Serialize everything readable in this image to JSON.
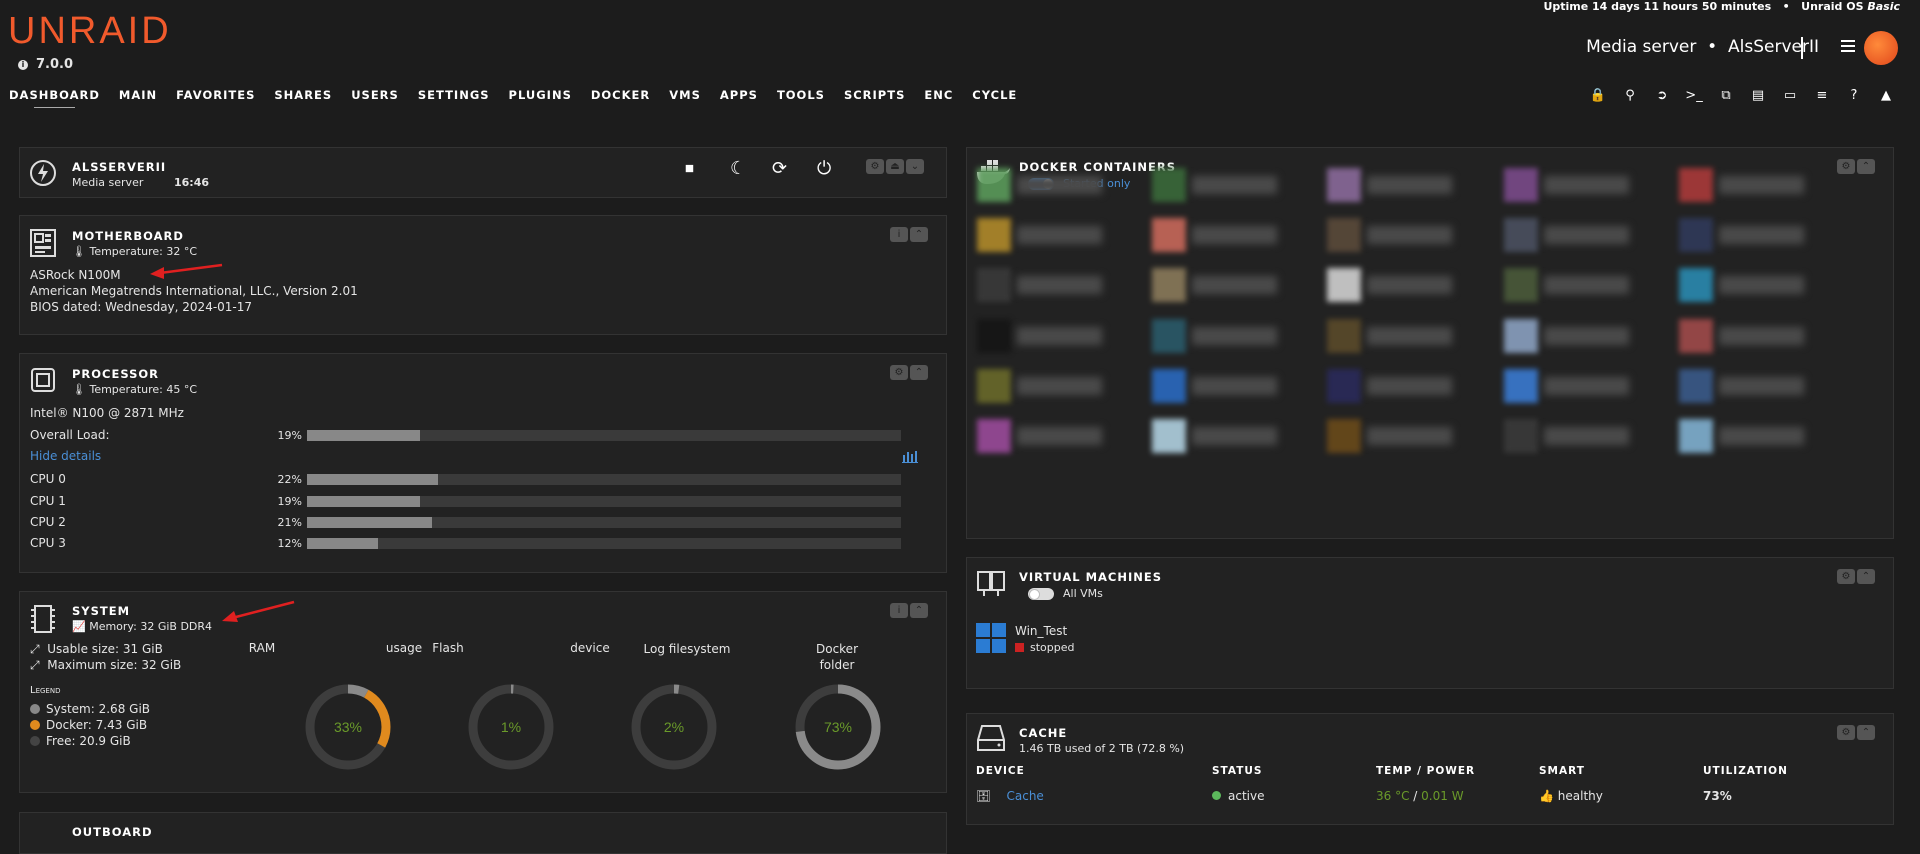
{
  "header": {
    "logo": "UNRAID",
    "version": "7.0.0",
    "uptime": "Uptime 14 days 11 hours 50 minutes",
    "os_label": "Unraid OS ",
    "os_edition": "Basic",
    "server_desc": "Media server",
    "server_name": "AlsServerII",
    "nav": [
      "DASHBOARD",
      "MAIN",
      "FAVORITES",
      "SHARES",
      "USERS",
      "SETTINGS",
      "PLUGINS",
      "DOCKER",
      "VMS",
      "APPS",
      "TOOLS",
      "SCRIPTS",
      "ENC",
      "CYCLE"
    ],
    "right_icons": [
      "lock-icon",
      "search-icon",
      "logout-icon",
      "terminal-icon",
      "copy-icon",
      "notes-icon",
      "monitor-icon",
      "log-icon",
      "help-icon",
      "bell-icon"
    ]
  },
  "server_panel": {
    "name": "ALSSERVERII",
    "desc": "Media server",
    "time": "16:46"
  },
  "motherboard": {
    "title": "MOTHERBOARD",
    "temp": "Temperature: 32 °C",
    "model": "ASRock N100M",
    "bios_vendor": "American Megatrends International, LLC., Version 2.01",
    "bios_date": "BIOS dated: Wednesday, 2024-01-17"
  },
  "processor": {
    "title": "PROCESSOR",
    "temp": "Temperature: 45 °C",
    "model": "Intel® N100 @ 2871 MHz",
    "overall_label": "Overall Load:",
    "overall_pct": "19%",
    "overall_value": 0.19,
    "hide_details": "Hide details",
    "cpus": [
      {
        "label": "CPU 0",
        "pct": "22%",
        "value": 0.22
      },
      {
        "label": "CPU 1",
        "pct": "19%",
        "value": 0.19
      },
      {
        "label": "CPU 2",
        "pct": "21%",
        "value": 0.21
      },
      {
        "label": "CPU 3",
        "pct": "12%",
        "value": 0.12
      }
    ]
  },
  "system": {
    "title": "SYSTEM",
    "memory": "Memory: 32 GiB DDR4",
    "usable": "Usable size: 31 GiB",
    "maximum": "Maximum size: 32 GiB",
    "legend_title": "Legend",
    "legend": [
      {
        "label": "System: 2.68 GiB",
        "color": "#888888"
      },
      {
        "label": "Docker: 7.43 GiB",
        "color": "#e08a1e"
      },
      {
        "label": "Free: 20.9 GiB",
        "color": "#444444"
      }
    ],
    "usage_label": "usage",
    "device_label": "device",
    "gauges": [
      {
        "label": "RAM",
        "value_text": "33%",
        "system": 0.08,
        "docker": 0.25
      },
      {
        "label": "Flash",
        "value_text": "1%",
        "system": 0.01,
        "docker": 0
      },
      {
        "label": "Log filesystem",
        "value_text": "2%",
        "system": 0.02,
        "docker": 0
      },
      {
        "label": "Docker folder",
        "value_text": "73%",
        "system": 0.73,
        "docker": 0
      }
    ]
  },
  "bottom_panel_title": "OUTBOARD",
  "docker": {
    "title": "DOCKER CONTAINERS",
    "toggle_label": "Started only"
  },
  "vms": {
    "title": "VIRTUAL MACHINES",
    "toggle_label": "All VMs",
    "vm_name": "Win_Test",
    "vm_status": "stopped"
  },
  "cache": {
    "title": "CACHE",
    "summary": "1.46 TB used of 2 TB (72.8 %)",
    "headers": [
      "DEVICE",
      "STATUS",
      "TEMP / POWER",
      "SMART",
      "UTILIZATION"
    ],
    "device": "Cache",
    "status": "active",
    "temp": "36 °C",
    "sep": "/",
    "power": "0.01 W",
    "smart": "healthy",
    "util": "73%"
  },
  "colors": {
    "accent": "#f15a2c",
    "link": "#4a8fd6",
    "ok": "#5cb85c",
    "temp_green": "#6a9a2a",
    "stopped": "#cc2222"
  }
}
